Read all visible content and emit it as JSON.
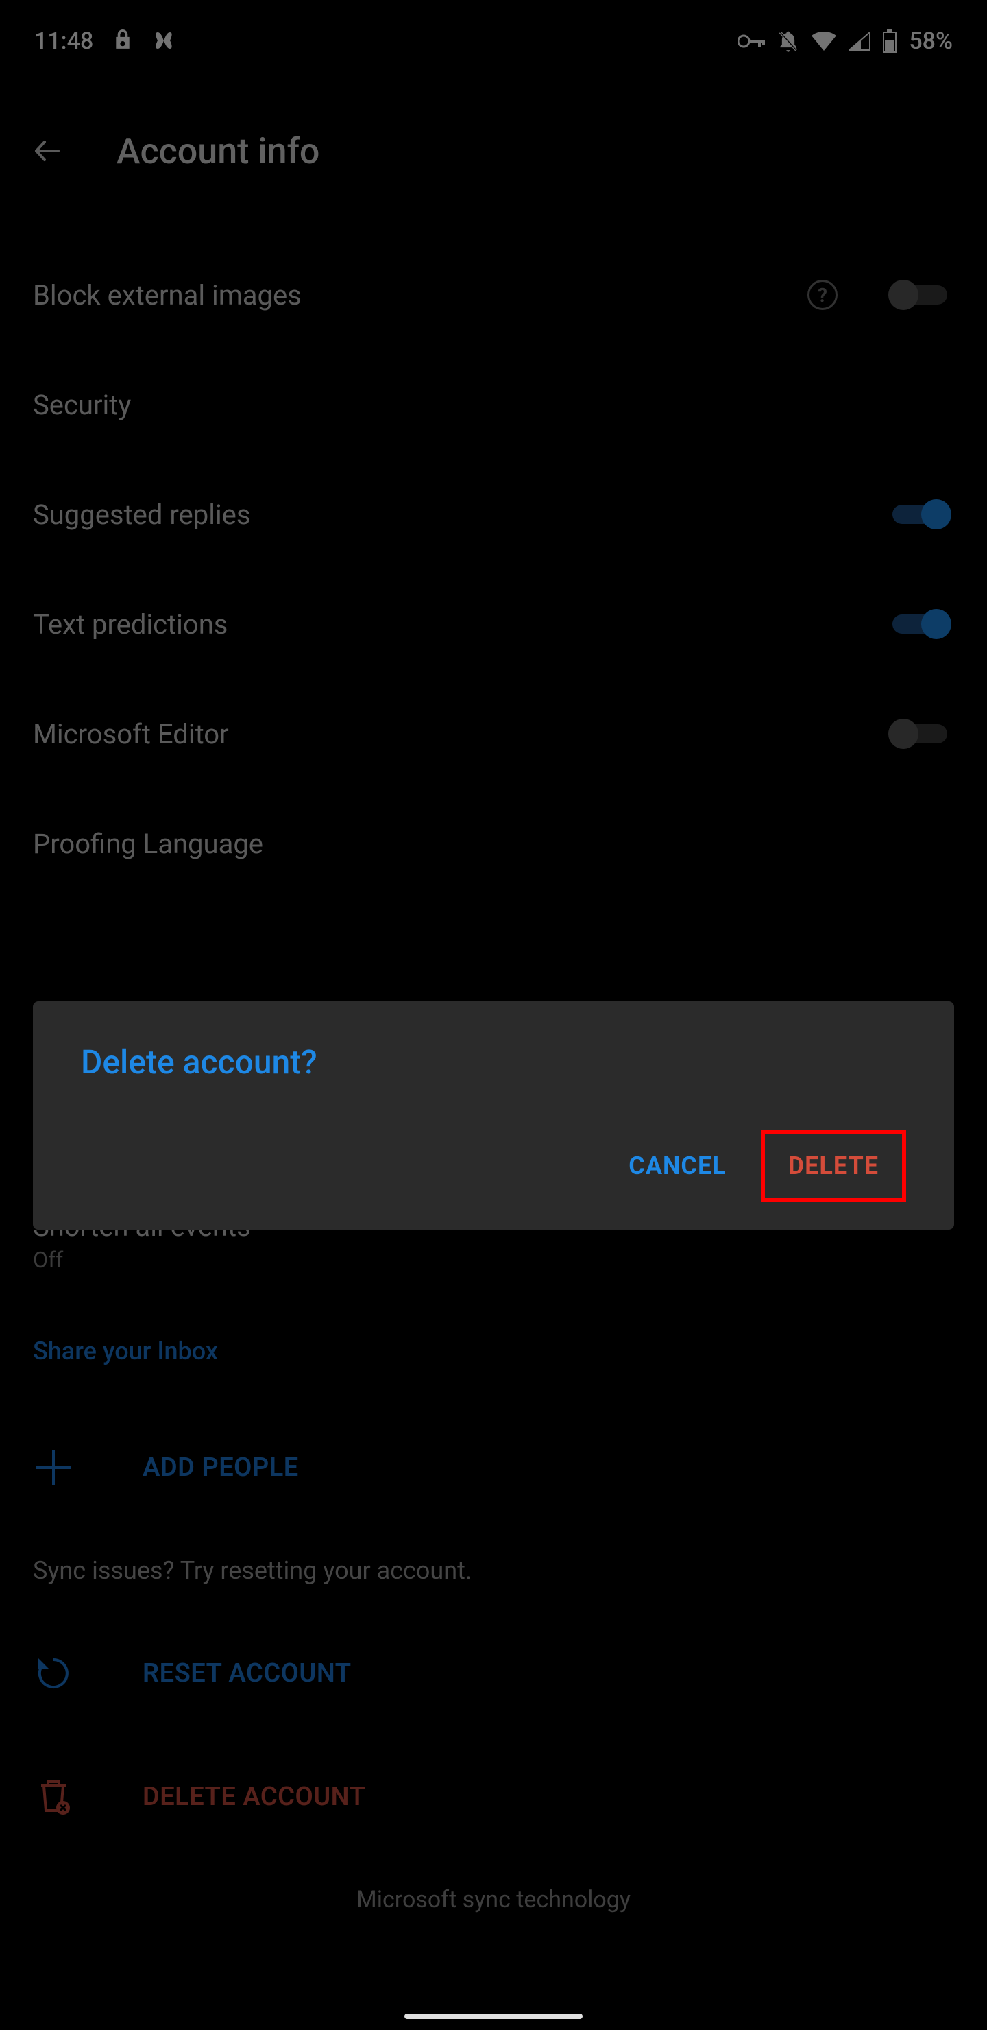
{
  "status": {
    "time": "11:48",
    "battery": "58%"
  },
  "appbar": {
    "title": "Account info"
  },
  "rows": {
    "block_external_images": "Block external images",
    "security": "Security",
    "suggested_replies": "Suggested replies",
    "text_predictions": "Text predictions",
    "microsoft_editor": "Microsoft Editor",
    "proofing_language": "Proofing Language",
    "shorten_all_events": "Shorten all events",
    "shorten_all_events_value": "Off"
  },
  "sections": {
    "share_inbox": "Share your Inbox",
    "sync_hint": "Sync issues? Try resetting your account."
  },
  "actions": {
    "add_people": "ADD PEOPLE",
    "reset_account": "RESET ACCOUNT",
    "delete_account": "DELETE ACCOUNT"
  },
  "footer": "Microsoft sync technology",
  "dialog": {
    "title": "Delete account?",
    "cancel": "CANCEL",
    "delete": "DELETE"
  }
}
